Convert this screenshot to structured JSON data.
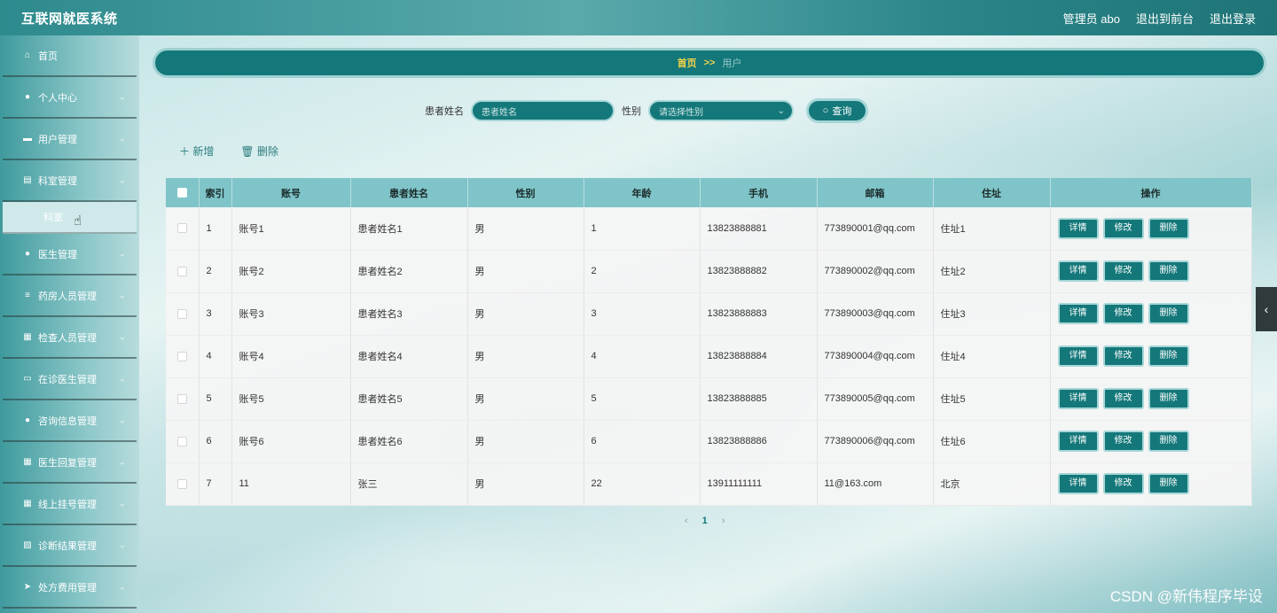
{
  "app": {
    "title": "互联网就医系统"
  },
  "top_actions": {
    "admin": "管理员 abo",
    "frontend": "退出到前台",
    "logout": "退出登录"
  },
  "sidebar": {
    "items": [
      {
        "label": "首页",
        "icon": "home-icon",
        "has_children": false
      },
      {
        "label": "个人中心",
        "icon": "user-icon",
        "has_children": true
      },
      {
        "label": "用户管理",
        "icon": "monitor-icon",
        "has_children": true
      },
      {
        "label": "科室管理",
        "icon": "document-icon",
        "has_children": true
      },
      {
        "label": "医生管理",
        "icon": "user-icon",
        "has_children": true
      },
      {
        "label": "药房人员管理",
        "icon": "list-icon",
        "has_children": true
      },
      {
        "label": "检查人员管理",
        "icon": "grid-icon",
        "has_children": true
      },
      {
        "label": "在诊医生管理",
        "icon": "printer-icon",
        "has_children": true
      },
      {
        "label": "咨询信息管理",
        "icon": "user-icon",
        "has_children": true
      },
      {
        "label": "医生回复管理",
        "icon": "grid-icon",
        "has_children": true
      },
      {
        "label": "线上挂号管理",
        "icon": "grid-icon",
        "has_children": true
      },
      {
        "label": "诊断结果管理",
        "icon": "image-icon",
        "has_children": true
      },
      {
        "label": "处方费用管理",
        "icon": "send-icon",
        "has_children": true
      }
    ],
    "active_sub": "科室"
  },
  "breadcrumb": {
    "home": "首页",
    "sep": ">>",
    "current": "用户"
  },
  "search": {
    "name_label": "患者姓名",
    "name_placeholder": "患者姓名",
    "gender_label": "性别",
    "gender_placeholder": "请选择性别",
    "button": "查询"
  },
  "toolbar": {
    "add": "新增",
    "delete": "删除"
  },
  "table": {
    "headers": [
      "索引",
      "账号",
      "患者姓名",
      "性别",
      "年龄",
      "手机",
      "邮箱",
      "住址",
      "操作"
    ],
    "rows": [
      [
        "1",
        "账号1",
        "患者姓名1",
        "男",
        "1",
        "13823888881",
        "773890001@qq.com",
        "住址1"
      ],
      [
        "2",
        "账号2",
        "患者姓名2",
        "男",
        "2",
        "13823888882",
        "773890002@qq.com",
        "住址2"
      ],
      [
        "3",
        "账号3",
        "患者姓名3",
        "男",
        "3",
        "13823888883",
        "773890003@qq.com",
        "住址3"
      ],
      [
        "4",
        "账号4",
        "患者姓名4",
        "男",
        "4",
        "13823888884",
        "773890004@qq.com",
        "住址4"
      ],
      [
        "5",
        "账号5",
        "患者姓名5",
        "男",
        "5",
        "13823888885",
        "773890005@qq.com",
        "住址5"
      ],
      [
        "6",
        "账号6",
        "患者姓名6",
        "男",
        "6",
        "13823888886",
        "773890006@qq.com",
        "住址6"
      ],
      [
        "7",
        "11",
        "张三",
        "男",
        "22",
        "13911111111",
        "11@163.com",
        "北京"
      ]
    ],
    "actions": [
      "详情",
      "修改",
      "删除"
    ]
  },
  "pager": {
    "prev": "‹",
    "current": "1",
    "next": "›"
  },
  "watermark": "CSDN @新伟程序毕设",
  "colors": {
    "primary": "#14787a",
    "header": "#7fc4c8",
    "crumb_home": "#f2d34a"
  }
}
